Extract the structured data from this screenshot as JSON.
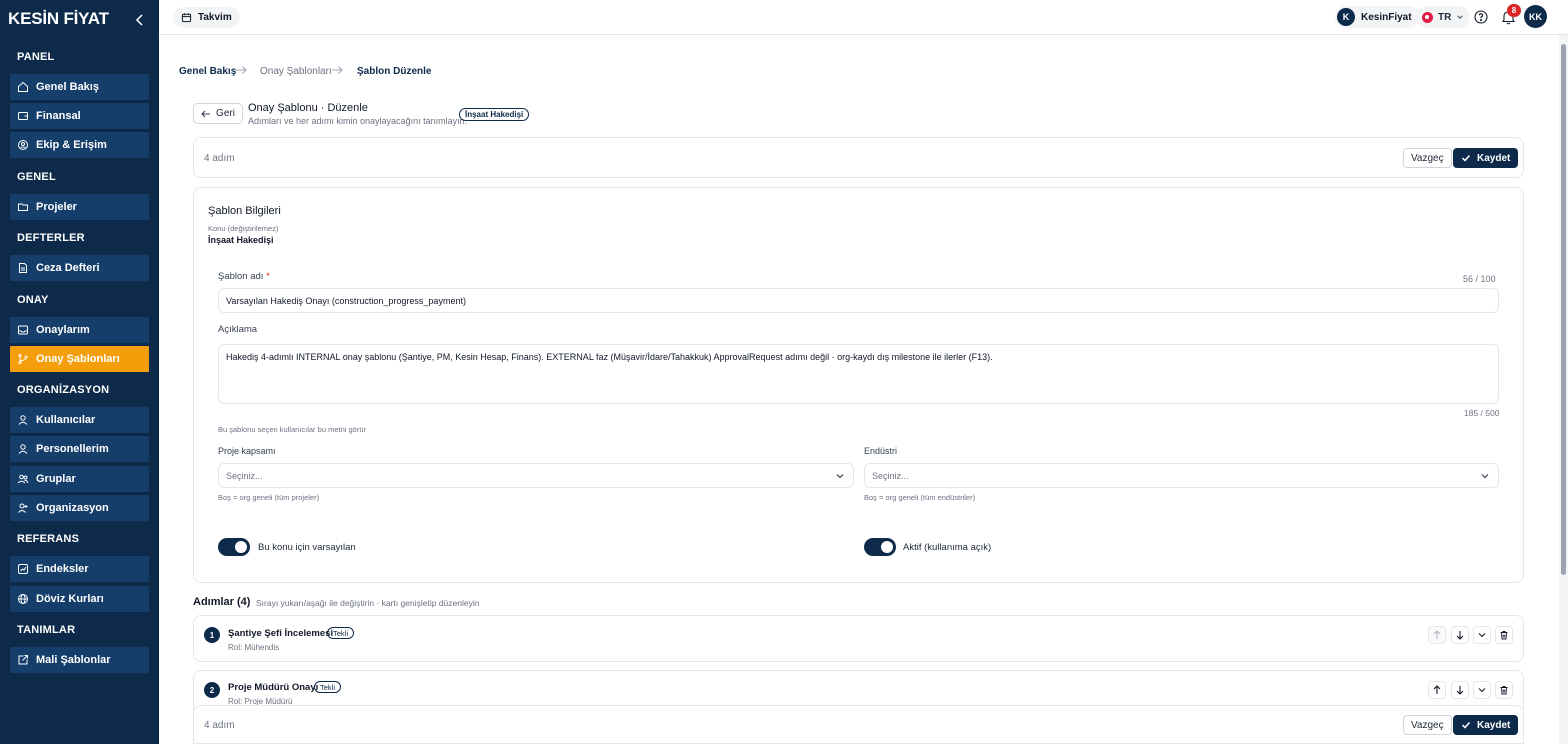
{
  "brand": {
    "logo_text": "KESİN FİYAT"
  },
  "sidebar": {
    "sections": [
      {
        "title": "PANEL",
        "items": [
          {
            "label": "Genel Bakış",
            "icon": "home-icon"
          },
          {
            "label": "Finansal",
            "icon": "wallet-icon"
          },
          {
            "label": "Ekip & Erişim",
            "icon": "shield-user-icon"
          }
        ]
      },
      {
        "title": "GENEL",
        "items": [
          {
            "label": "Projeler",
            "icon": "folder-icon"
          }
        ]
      },
      {
        "title": "DEFTERLER",
        "items": [
          {
            "label": "Ceza Defteri",
            "icon": "document-icon"
          }
        ]
      },
      {
        "title": "ONAY",
        "items": [
          {
            "label": "Onaylarım",
            "icon": "inbox-icon"
          },
          {
            "label": "Onay Şablonları",
            "icon": "branch-icon",
            "active": true
          }
        ]
      },
      {
        "title": "ORGANİZASYON",
        "items": [
          {
            "label": "Kullanıcılar",
            "icon": "user-icon"
          },
          {
            "label": "Personellerim",
            "icon": "user-icon"
          },
          {
            "label": "Gruplar",
            "icon": "users-icon"
          },
          {
            "label": "Organizasyon",
            "icon": "org-icon"
          }
        ]
      },
      {
        "title": "REFERANS",
        "items": [
          {
            "label": "Endeksler",
            "icon": "chart-icon"
          },
          {
            "label": "Döviz Kurları",
            "icon": "globe-icon"
          }
        ]
      },
      {
        "title": "TANIMLAR",
        "items": [
          {
            "label": "Mali Şablonlar",
            "icon": "external-icon"
          }
        ]
      }
    ],
    "accent_color": "#f59e0b",
    "background_color": "#0d2a4a"
  },
  "topbar": {
    "calendar_label": "Takvim",
    "org_avatar": "K",
    "org_name": "KesinFiyat",
    "lang": "TR",
    "notification_count": "8",
    "user_initials": "KK"
  },
  "breadcrumb": [
    "Genel Bakış",
    "Onay Şablonları",
    "Şablon Düzenle"
  ],
  "header": {
    "back_label": "Geri",
    "title": "Onay Şablonu · Düzenle",
    "subtitle": "Adımları ve her adımı kimin onaylayacağını tanımlayın.",
    "tag": "İnşaat Hakedişi"
  },
  "action_bar": {
    "steps_count": "4 adım",
    "cancel_label": "Vazgeç",
    "save_label": "Kaydet"
  },
  "template_info": {
    "section_title": "Şablon Bilgileri",
    "subject_label": "Konu (değiştirilemez)",
    "subject_value": "İnşaat Hakedişi",
    "name_label": "Şablon adı",
    "name_required": "*",
    "name_counter": "56 / 100",
    "name_value": "Varsayılan Hakediş Onayı (construction_progress_payment)",
    "description_label": "Açıklama",
    "description_value": "Hakediş 4-adımlı INTERNAL onay şablonu (Şantiye, PM, Kesin Hesap, Finans). EXTERNAL faz (Müşavir/İdare/Tahakkuk) ApprovalRequest adımı değil · org-kaydı dış milestone ile ilerler (F13).",
    "description_counter": "185 / 500",
    "description_hint": "Bu şablonu seçen kullanıcılar bu metni görür",
    "project_scope_label": "Proje kapsamı",
    "project_scope_placeholder": "Seçiniz...",
    "project_scope_hint": "Boş = org geneli (tüm projeler)",
    "industry_label": "Endüstri",
    "industry_placeholder": "Seçiniz...",
    "industry_hint": "Boş = org geneli (tüm endüstriler)",
    "default_toggle_label": "Bu konu için varsayılan",
    "default_toggle_on": true,
    "active_toggle_label": "Aktif (kullanıma açık)",
    "active_toggle_on": true
  },
  "steps": {
    "title": "Adımlar (4)",
    "hint": "Sırayı yukarı/aşağı ile değiştirin · kartı genişletip düzenleyin",
    "items": [
      {
        "number": "1",
        "title": "Şantiye Şefi İncelemesi",
        "tag": "Tekli",
        "role": "Rol: Mühendis"
      },
      {
        "number": "2",
        "title": "Proje Müdürü Onayı",
        "tag": "Tekli",
        "role": "Rol: Proje Müdürü"
      }
    ]
  },
  "footer_bar": {
    "steps_count": "4 adım",
    "cancel_label": "Vazgeç",
    "save_label": "Kaydet"
  }
}
